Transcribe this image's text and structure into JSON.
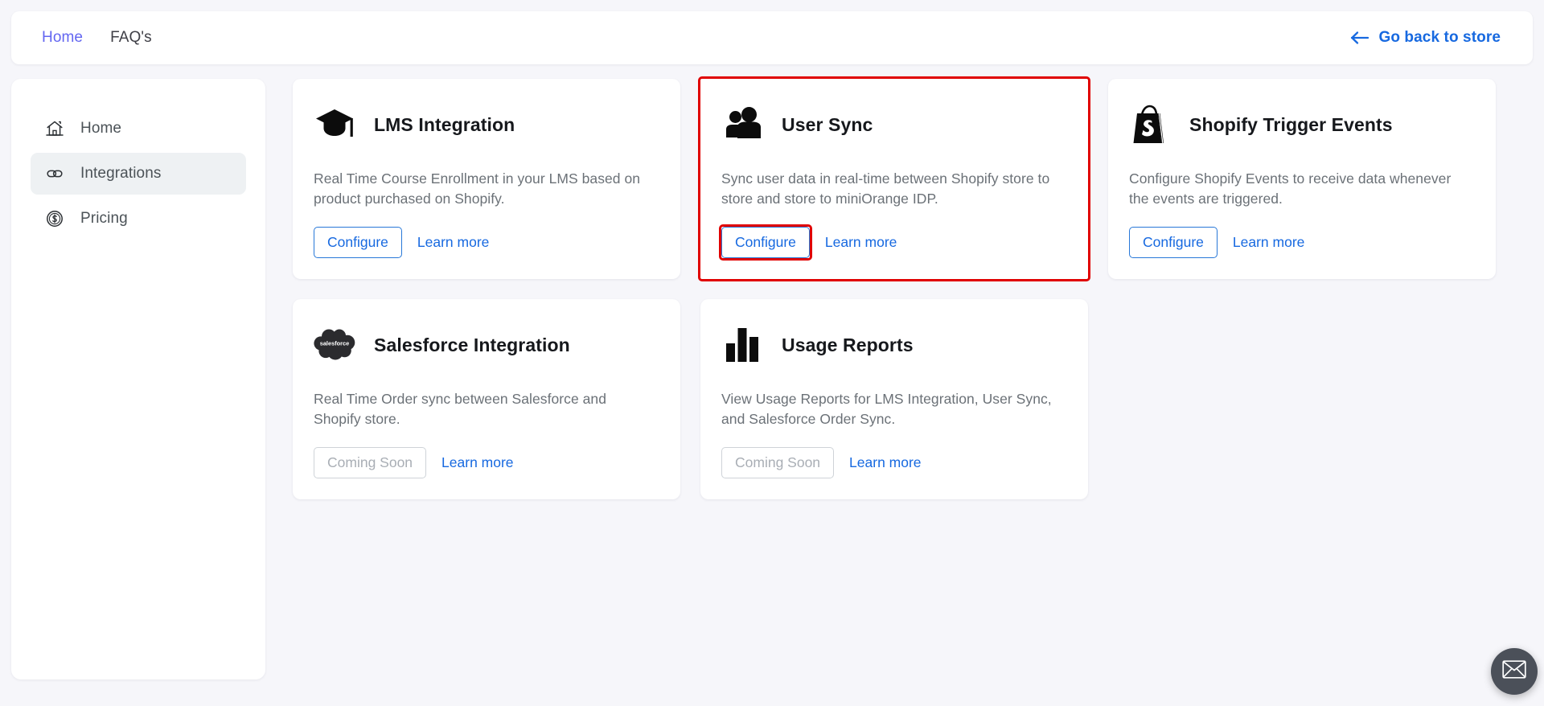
{
  "topbar": {
    "nav": [
      {
        "label": "Home",
        "active": true,
        "name": "topnav-home"
      },
      {
        "label": "FAQ's",
        "active": false,
        "name": "topnav-faqs"
      }
    ],
    "back_link": {
      "label": "Go back to store",
      "icon": "arrow-left-icon",
      "color": "#1769e0"
    }
  },
  "sidebar": {
    "items": [
      {
        "label": "Home",
        "icon": "house-icon",
        "active": false
      },
      {
        "label": "Integrations",
        "icon": "link-chain-icon",
        "active": true
      },
      {
        "label": "Pricing",
        "icon": "dollar-coin-icon",
        "active": false
      }
    ],
    "active_bg": "#eef1f3"
  },
  "cards": [
    {
      "id": "lms-integration",
      "title": "LMS Integration",
      "icon": "graduation-cap-icon",
      "description": "Real Time Course Enrollment in your LMS based on product purchased on Shopify.",
      "primary_button": "Configure",
      "primary_state": "enabled",
      "learn_more": "Learn more",
      "highlighted": false,
      "button_highlighted": false
    },
    {
      "id": "user-sync",
      "title": "User Sync",
      "icon": "two-users-icon",
      "description": "Sync user data in real-time between Shopify store to store and store to miniOrange IDP.",
      "primary_button": "Configure",
      "primary_state": "enabled",
      "learn_more": "Learn more",
      "highlighted": true,
      "button_highlighted": true
    },
    {
      "id": "shopify-trigger-events",
      "title": "Shopify Trigger Events",
      "icon": "shopify-bag-icon",
      "description": "Configure Shopify Events to receive data whenever the events are triggered.",
      "primary_button": "Configure",
      "primary_state": "enabled",
      "learn_more": "Learn more",
      "highlighted": false,
      "button_highlighted": false
    },
    {
      "id": "salesforce-integration",
      "title": "Salesforce Integration",
      "icon": "salesforce-cloud-icon",
      "description": "Real Time Order sync between Salesforce and Shopify store.",
      "primary_button": "Coming Soon",
      "primary_state": "disabled",
      "learn_more": "Learn more",
      "highlighted": false,
      "button_highlighted": false
    },
    {
      "id": "usage-reports",
      "title": "Usage Reports",
      "icon": "bar-chart-icon",
      "description": "View Usage Reports for LMS Integration, User Sync, and Salesforce Order Sync.",
      "primary_button": "Coming Soon",
      "primary_state": "disabled",
      "learn_more": "Learn more",
      "highlighted": false,
      "button_highlighted": false
    }
  ],
  "floating_action": {
    "icon": "envelope-icon",
    "background": "#4b5059"
  },
  "theme": {
    "page_background": "#f6f6fa",
    "accent_blue": "#1769e0",
    "accent_purple": "#6366f1",
    "highlight_red": "#e00000"
  }
}
